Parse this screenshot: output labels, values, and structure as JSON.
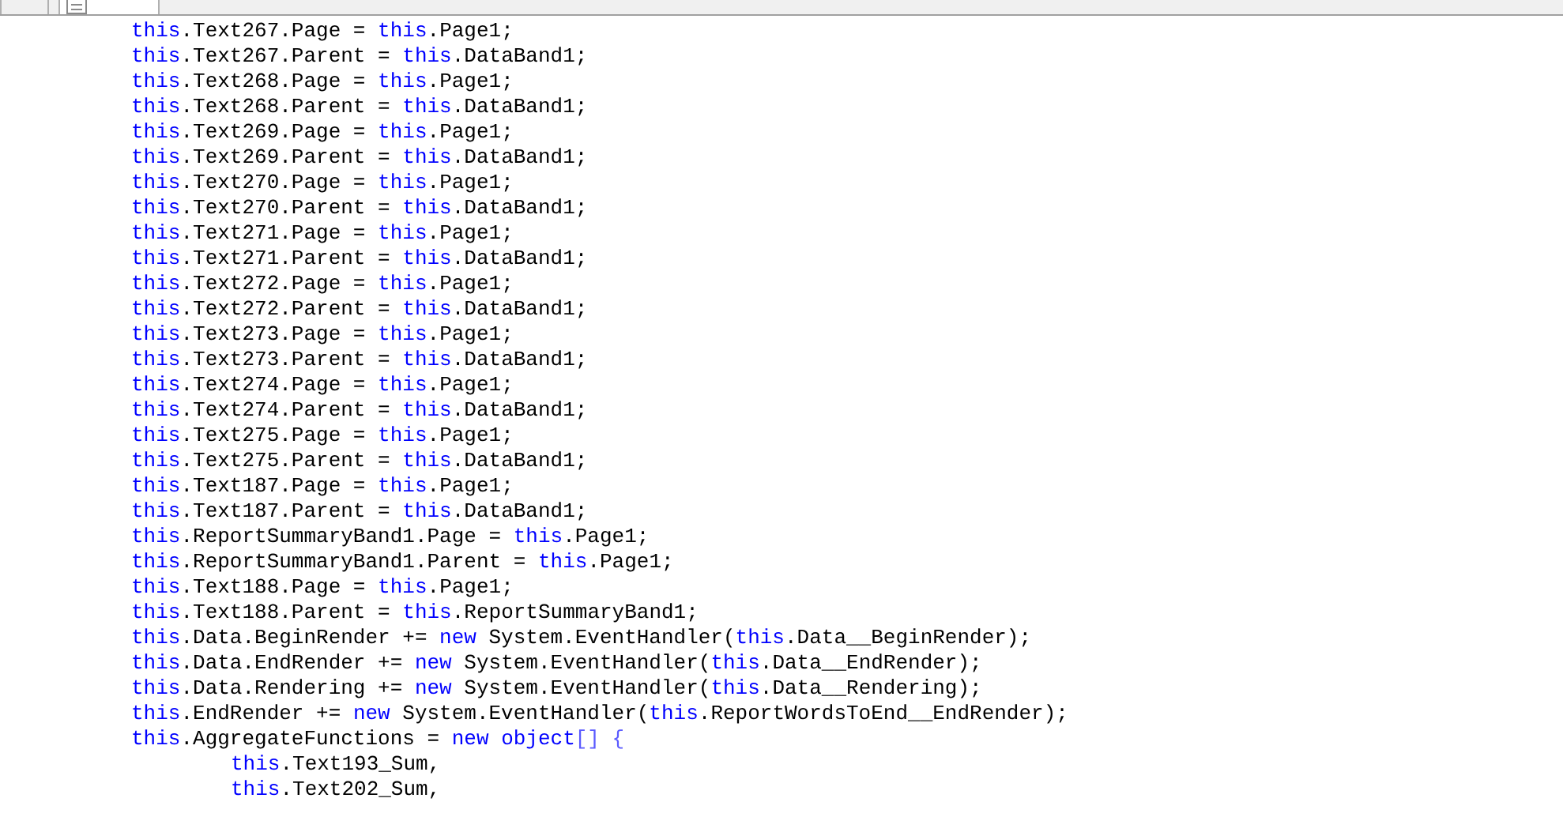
{
  "tabs": [
    {
      "kind": "plain",
      "selected": false
    },
    {
      "kind": "document",
      "selected": true
    }
  ],
  "code": [
    {
      "tokens": [
        {
          "kind": "keyword",
          "text": "this"
        },
        {
          "kind": "identifier",
          "text": ".Text267.Page = "
        },
        {
          "kind": "keyword",
          "text": "this"
        },
        {
          "kind": "identifier",
          "text": ".Page1;"
        }
      ]
    },
    {
      "tokens": [
        {
          "kind": "keyword",
          "text": "this"
        },
        {
          "kind": "identifier",
          "text": ".Text267.Parent = "
        },
        {
          "kind": "keyword",
          "text": "this"
        },
        {
          "kind": "identifier",
          "text": ".DataBand1;"
        }
      ]
    },
    {
      "tokens": [
        {
          "kind": "keyword",
          "text": "this"
        },
        {
          "kind": "identifier",
          "text": ".Text268.Page = "
        },
        {
          "kind": "keyword",
          "text": "this"
        },
        {
          "kind": "identifier",
          "text": ".Page1;"
        }
      ]
    },
    {
      "tokens": [
        {
          "kind": "keyword",
          "text": "this"
        },
        {
          "kind": "identifier",
          "text": ".Text268.Parent = "
        },
        {
          "kind": "keyword",
          "text": "this"
        },
        {
          "kind": "identifier",
          "text": ".DataBand1;"
        }
      ]
    },
    {
      "tokens": [
        {
          "kind": "keyword",
          "text": "this"
        },
        {
          "kind": "identifier",
          "text": ".Text269.Page = "
        },
        {
          "kind": "keyword",
          "text": "this"
        },
        {
          "kind": "identifier",
          "text": ".Page1;"
        }
      ]
    },
    {
      "tokens": [
        {
          "kind": "keyword",
          "text": "this"
        },
        {
          "kind": "identifier",
          "text": ".Text269.Parent = "
        },
        {
          "kind": "keyword",
          "text": "this"
        },
        {
          "kind": "identifier",
          "text": ".DataBand1;"
        }
      ]
    },
    {
      "tokens": [
        {
          "kind": "keyword",
          "text": "this"
        },
        {
          "kind": "identifier",
          "text": ".Text270.Page = "
        },
        {
          "kind": "keyword",
          "text": "this"
        },
        {
          "kind": "identifier",
          "text": ".Page1;"
        }
      ]
    },
    {
      "tokens": [
        {
          "kind": "keyword",
          "text": "this"
        },
        {
          "kind": "identifier",
          "text": ".Text270.Parent = "
        },
        {
          "kind": "keyword",
          "text": "this"
        },
        {
          "kind": "identifier",
          "text": ".DataBand1;"
        }
      ]
    },
    {
      "tokens": [
        {
          "kind": "keyword",
          "text": "this"
        },
        {
          "kind": "identifier",
          "text": ".Text271.Page = "
        },
        {
          "kind": "keyword",
          "text": "this"
        },
        {
          "kind": "identifier",
          "text": ".Page1;"
        }
      ]
    },
    {
      "tokens": [
        {
          "kind": "keyword",
          "text": "this"
        },
        {
          "kind": "identifier",
          "text": ".Text271.Parent = "
        },
        {
          "kind": "keyword",
          "text": "this"
        },
        {
          "kind": "identifier",
          "text": ".DataBand1;"
        }
      ]
    },
    {
      "tokens": [
        {
          "kind": "keyword",
          "text": "this"
        },
        {
          "kind": "identifier",
          "text": ".Text272.Page = "
        },
        {
          "kind": "keyword",
          "text": "this"
        },
        {
          "kind": "identifier",
          "text": ".Page1;"
        }
      ]
    },
    {
      "tokens": [
        {
          "kind": "keyword",
          "text": "this"
        },
        {
          "kind": "identifier",
          "text": ".Text272.Parent = "
        },
        {
          "kind": "keyword",
          "text": "this"
        },
        {
          "kind": "identifier",
          "text": ".DataBand1;"
        }
      ]
    },
    {
      "tokens": [
        {
          "kind": "keyword",
          "text": "this"
        },
        {
          "kind": "identifier",
          "text": ".Text273.Page = "
        },
        {
          "kind": "keyword",
          "text": "this"
        },
        {
          "kind": "identifier",
          "text": ".Page1;"
        }
      ]
    },
    {
      "tokens": [
        {
          "kind": "keyword",
          "text": "this"
        },
        {
          "kind": "identifier",
          "text": ".Text273.Parent = "
        },
        {
          "kind": "keyword",
          "text": "this"
        },
        {
          "kind": "identifier",
          "text": ".DataBand1;"
        }
      ]
    },
    {
      "tokens": [
        {
          "kind": "keyword",
          "text": "this"
        },
        {
          "kind": "identifier",
          "text": ".Text274.Page = "
        },
        {
          "kind": "keyword",
          "text": "this"
        },
        {
          "kind": "identifier",
          "text": ".Page1;"
        }
      ]
    },
    {
      "tokens": [
        {
          "kind": "keyword",
          "text": "this"
        },
        {
          "kind": "identifier",
          "text": ".Text274.Parent = "
        },
        {
          "kind": "keyword",
          "text": "this"
        },
        {
          "kind": "identifier",
          "text": ".DataBand1;"
        }
      ]
    },
    {
      "tokens": [
        {
          "kind": "keyword",
          "text": "this"
        },
        {
          "kind": "identifier",
          "text": ".Text275.Page = "
        },
        {
          "kind": "keyword",
          "text": "this"
        },
        {
          "kind": "identifier",
          "text": ".Page1;"
        }
      ]
    },
    {
      "tokens": [
        {
          "kind": "keyword",
          "text": "this"
        },
        {
          "kind": "identifier",
          "text": ".Text275.Parent = "
        },
        {
          "kind": "keyword",
          "text": "this"
        },
        {
          "kind": "identifier",
          "text": ".DataBand1;"
        }
      ]
    },
    {
      "tokens": [
        {
          "kind": "keyword",
          "text": "this"
        },
        {
          "kind": "identifier",
          "text": ".Text187.Page = "
        },
        {
          "kind": "keyword",
          "text": "this"
        },
        {
          "kind": "identifier",
          "text": ".Page1;"
        }
      ]
    },
    {
      "tokens": [
        {
          "kind": "keyword",
          "text": "this"
        },
        {
          "kind": "identifier",
          "text": ".Text187.Parent = "
        },
        {
          "kind": "keyword",
          "text": "this"
        },
        {
          "kind": "identifier",
          "text": ".DataBand1;"
        }
      ]
    },
    {
      "tokens": [
        {
          "kind": "keyword",
          "text": "this"
        },
        {
          "kind": "identifier",
          "text": ".ReportSummaryBand1.Page = "
        },
        {
          "kind": "keyword",
          "text": "this"
        },
        {
          "kind": "identifier",
          "text": ".Page1;"
        }
      ]
    },
    {
      "tokens": [
        {
          "kind": "keyword",
          "text": "this"
        },
        {
          "kind": "identifier",
          "text": ".ReportSummaryBand1.Parent = "
        },
        {
          "kind": "keyword",
          "text": "this"
        },
        {
          "kind": "identifier",
          "text": ".Page1;"
        }
      ]
    },
    {
      "tokens": [
        {
          "kind": "keyword",
          "text": "this"
        },
        {
          "kind": "identifier",
          "text": ".Text188.Page = "
        },
        {
          "kind": "keyword",
          "text": "this"
        },
        {
          "kind": "identifier",
          "text": ".Page1;"
        }
      ]
    },
    {
      "tokens": [
        {
          "kind": "keyword",
          "text": "this"
        },
        {
          "kind": "identifier",
          "text": ".Text188.Parent = "
        },
        {
          "kind": "keyword",
          "text": "this"
        },
        {
          "kind": "identifier",
          "text": ".ReportSummaryBand1;"
        }
      ]
    },
    {
      "tokens": [
        {
          "kind": "keyword",
          "text": "this"
        },
        {
          "kind": "identifier",
          "text": ".Data.BeginRender += "
        },
        {
          "kind": "keyword",
          "text": "new"
        },
        {
          "kind": "identifier",
          "text": " System.EventHandler("
        },
        {
          "kind": "keyword",
          "text": "this"
        },
        {
          "kind": "identifier",
          "text": ".Data__BeginRender);"
        }
      ]
    },
    {
      "tokens": [
        {
          "kind": "keyword",
          "text": "this"
        },
        {
          "kind": "identifier",
          "text": ".Data.EndRender += "
        },
        {
          "kind": "keyword",
          "text": "new"
        },
        {
          "kind": "identifier",
          "text": " System.EventHandler("
        },
        {
          "kind": "keyword",
          "text": "this"
        },
        {
          "kind": "identifier",
          "text": ".Data__EndRender);"
        }
      ]
    },
    {
      "tokens": [
        {
          "kind": "keyword",
          "text": "this"
        },
        {
          "kind": "identifier",
          "text": ".Data.Rendering += "
        },
        {
          "kind": "keyword",
          "text": "new"
        },
        {
          "kind": "identifier",
          "text": " System.EventHandler("
        },
        {
          "kind": "keyword",
          "text": "this"
        },
        {
          "kind": "identifier",
          "text": ".Data__Rendering);"
        }
      ]
    },
    {
      "tokens": [
        {
          "kind": "keyword",
          "text": "this"
        },
        {
          "kind": "identifier",
          "text": ".EndRender += "
        },
        {
          "kind": "keyword",
          "text": "new"
        },
        {
          "kind": "identifier",
          "text": " System.EventHandler("
        },
        {
          "kind": "keyword",
          "text": "this"
        },
        {
          "kind": "identifier",
          "text": ".ReportWordsToEnd__EndRender);"
        }
      ]
    },
    {
      "tokens": [
        {
          "kind": "keyword",
          "text": "this"
        },
        {
          "kind": "identifier",
          "text": ".AggregateFunctions = "
        },
        {
          "kind": "keyword",
          "text": "new object"
        },
        {
          "kind": "bracket",
          "text": "[] {"
        }
      ],
      "children": [
        {
          "tokens": [
            {
              "kind": "keyword",
              "text": "this"
            },
            {
              "kind": "identifier",
              "text": ".Text193_Sum,"
            }
          ]
        },
        {
          "tokens": [
            {
              "kind": "keyword",
              "text": "this"
            },
            {
              "kind": "identifier",
              "text": ".Text202_Sum,"
            }
          ]
        }
      ]
    }
  ]
}
